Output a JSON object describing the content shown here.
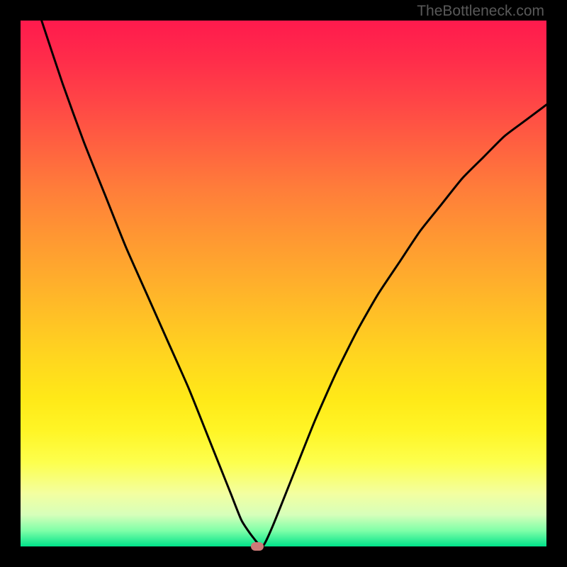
{
  "watermark": "TheBottleneck.com",
  "chart_data": {
    "type": "line",
    "title": "",
    "xlabel": "",
    "ylabel": "",
    "xlim": [
      0,
      100
    ],
    "ylim": [
      0,
      100
    ],
    "x": [
      4,
      8,
      12,
      16,
      20,
      24,
      28,
      32,
      36,
      38,
      40,
      42,
      44,
      46,
      48,
      52,
      56,
      60,
      64,
      68,
      72,
      76,
      80,
      84,
      88,
      92,
      96,
      100
    ],
    "y": [
      100,
      88,
      77,
      67,
      57,
      48,
      39,
      30,
      20,
      15,
      10,
      5,
      2,
      0,
      4,
      14,
      24,
      33,
      41,
      48,
      54,
      60,
      65,
      70,
      74,
      78,
      81,
      84
    ],
    "marker": {
      "x": 45,
      "y": 0
    },
    "background_gradient": {
      "top": "#ff1a4d",
      "mid": "#ffe918",
      "bottom": "#00e38a"
    }
  }
}
